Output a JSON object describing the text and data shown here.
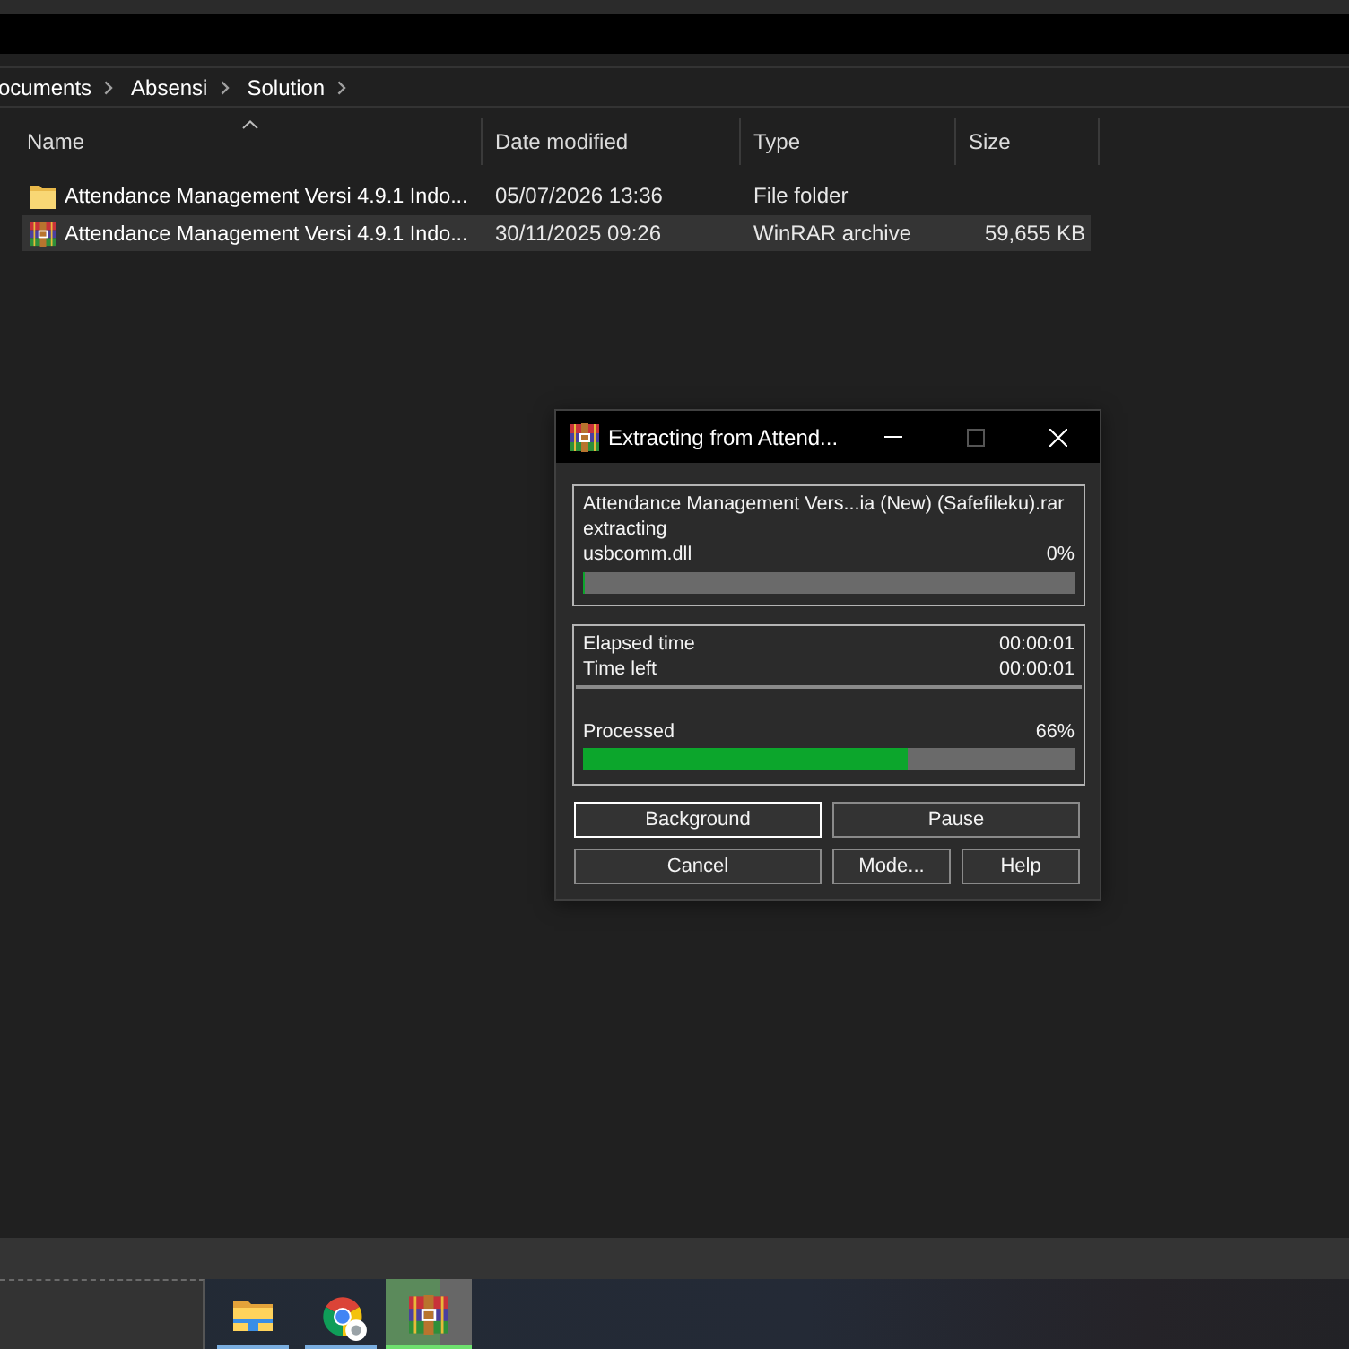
{
  "explorer": {
    "breadcrumb": [
      "ocuments",
      "Absensi",
      "Solution"
    ],
    "columns": [
      {
        "label": "Name",
        "sorted": true
      },
      {
        "label": "Date modified",
        "sorted": false
      },
      {
        "label": "Type",
        "sorted": false
      },
      {
        "label": "Size",
        "sorted": false
      }
    ],
    "rows": [
      {
        "kind": "folder",
        "name": "Attendance Management Versi 4.9.1 Indo...",
        "date_modified": "05/07/2026 13:36",
        "type": "File folder",
        "selected": false
      },
      {
        "kind": "archive",
        "name": "Attendance Management Versi 4.9.1 Indo...",
        "date_modified": "30/11/2025 09:26",
        "type": "WinRAR archive",
        "size": "59,655 KB",
        "selected": true
      }
    ]
  },
  "dialog": {
    "title": "Extracting from Attend...",
    "window_buttons": [
      {
        "kind": "minimize",
        "disabled": false
      },
      {
        "kind": "maximize",
        "disabled": true
      },
      {
        "kind": "close",
        "disabled": false
      }
    ],
    "archive": "Attendance Management Vers...ia (New) (Safefileku).rar",
    "action": "extracting",
    "current_file": "usbcomm.dll",
    "file_percent": "0%",
    "file_progress": {
      "level": 0
    },
    "times": [
      {
        "label": "Elapsed time",
        "value": "00:00:01"
      },
      {
        "label": "Time left",
        "value": "00:00:01"
      }
    ],
    "processed": {
      "label": "Processed",
      "percent": "66%",
      "level": 0.66
    },
    "buttons": [
      [
        {
          "label": "Background",
          "focused": true
        },
        {
          "label": "Pause",
          "focused": false
        }
      ],
      [
        {
          "label": "Cancel",
          "focused": false
        },
        {
          "label": "Mode...",
          "focused": false
        },
        {
          "label": "Help",
          "focused": false
        }
      ]
    ]
  },
  "taskbar": {
    "items": [
      {
        "kind": "folder",
        "running": true,
        "active": false
      },
      {
        "kind": "browser",
        "running": true,
        "active": false
      },
      {
        "kind": "archiver",
        "running": true,
        "active": true,
        "level": 0.63
      }
    ]
  }
}
